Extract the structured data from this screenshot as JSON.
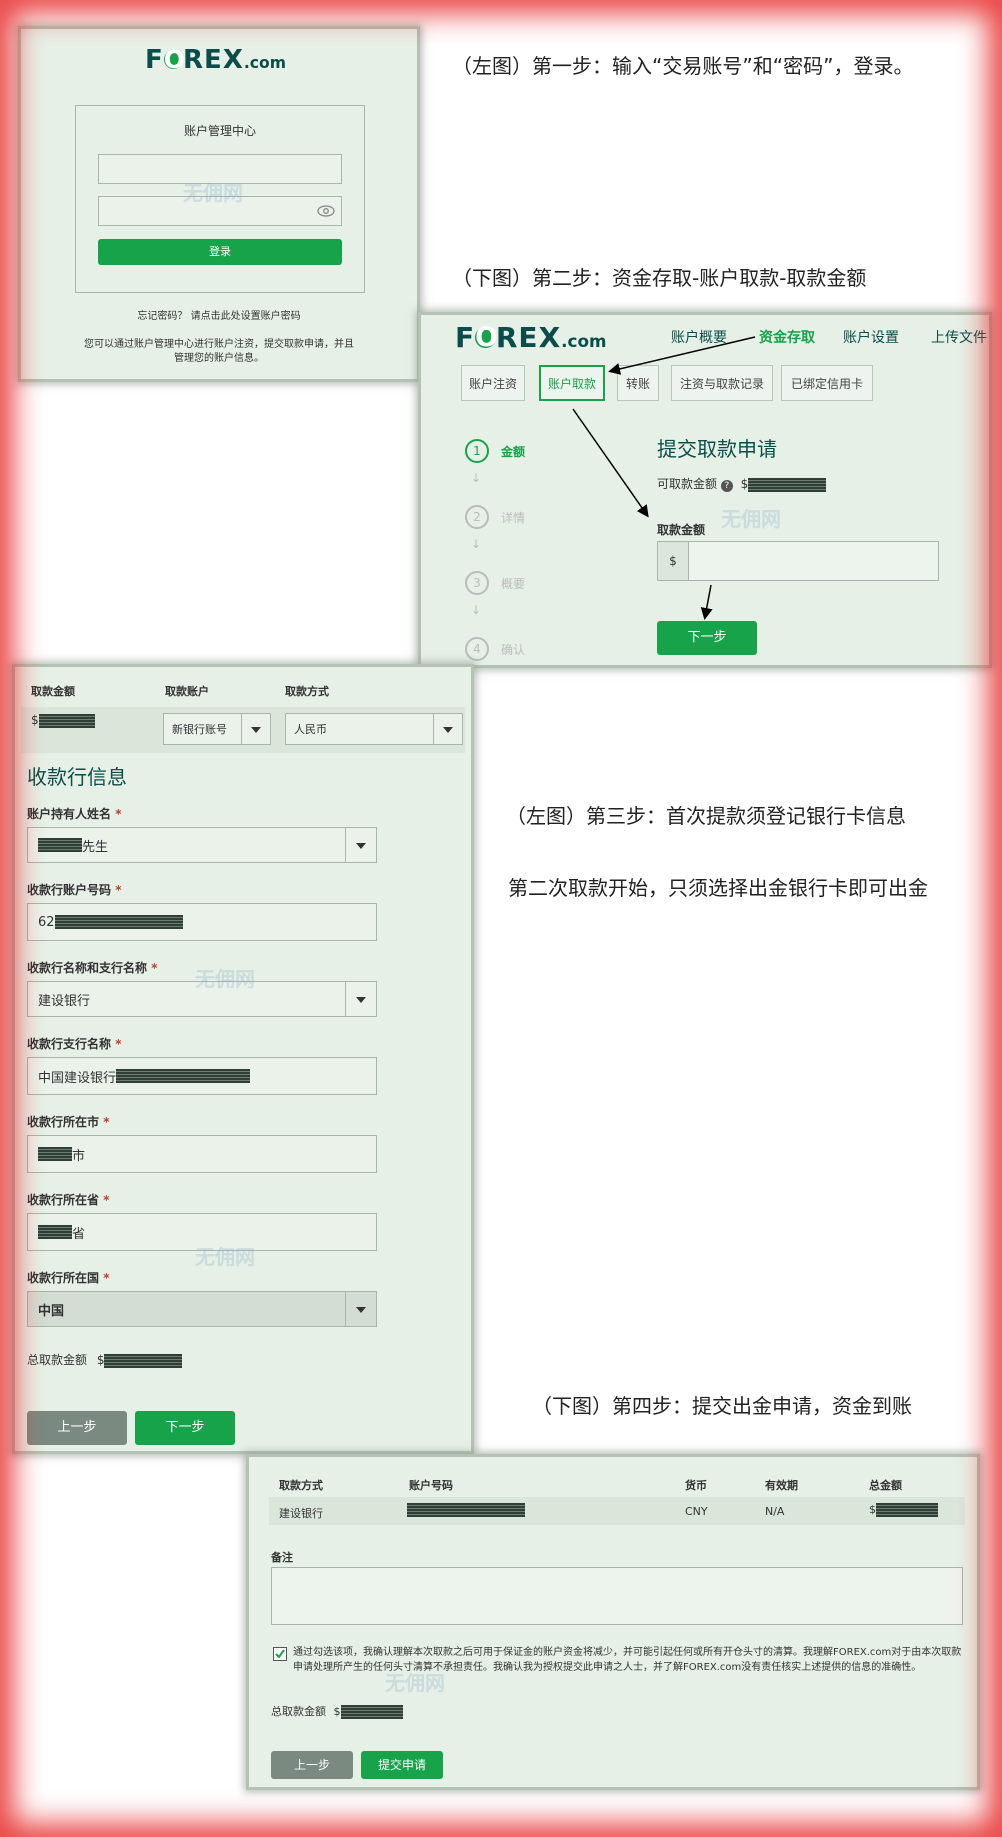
{
  "captions": {
    "step1": "（左图）第一步：输入“交易账号”和“密码”，登录。",
    "step2": "（下图）第二步：资金存取-账户取款-取款金额",
    "step3a": "（左图）第三步：首次提款须登记银行卡信息",
    "step3b": "第二次取款开始，只须选择出金银行卡即可出金",
    "step4": "（下图）第四步：提交出金申请，资金到账"
  },
  "brand": {
    "logo_pre": "F",
    "logo_o": "O",
    "logo_post": "REX",
    "logo_suffix": ".com",
    "accent": "#16a34a"
  },
  "watermark": "无佣网",
  "login": {
    "title": "账户管理中心",
    "account_placeholder": "",
    "password_placeholder": "",
    "login_button": "登录",
    "forgot_text": "忘记密码？ 请点击此处设置账户密码",
    "desc_line1": "您可以通过账户管理中心进行账户注资，提交取款申请，并且",
    "desc_line2": "管理您的账户信息。"
  },
  "withdraw": {
    "nav": [
      "账户概要",
      "资金存取",
      "账户设置",
      "上传文件"
    ],
    "tabs": [
      "账户注资",
      "账户取款",
      "转账",
      "注资与取款记录",
      "已绑定信用卡"
    ],
    "steps": [
      {
        "num": "1",
        "label": "金额"
      },
      {
        "num": "2",
        "label": "详情"
      },
      {
        "num": "3",
        "label": "概要"
      },
      {
        "num": "4",
        "label": "确认"
      }
    ],
    "title": "提交取款申请",
    "available_label": "可取款金额",
    "currency_symbol": "$",
    "amount_label": "取款金额",
    "next_button": "下一步"
  },
  "bank": {
    "headers": [
      "取款金额",
      "取款账户",
      "取款方式"
    ],
    "amount_prefix": "$",
    "account_select": "新银行账号",
    "method_select": "人民币",
    "section_title": "收款行信息",
    "required_mark": "*",
    "fields": [
      {
        "label": "账户持有人姓名",
        "value": "先生"
      },
      {
        "label": "收款行账户号码",
        "value": "62"
      },
      {
        "label": "收款行名称和支行名称",
        "value": "建设银行"
      },
      {
        "label": "收款行支行名称",
        "value": "中国建设银行"
      },
      {
        "label": "收款行所在市",
        "value": "市"
      },
      {
        "label": "收款行所在省",
        "value": "省"
      },
      {
        "label": "收款行所在国",
        "value": "中国"
      }
    ],
    "total_label": "总取款金额",
    "total_prefix": "$",
    "prev_button": "上一步",
    "next_button": "下一步"
  },
  "confirm": {
    "headers": [
      "取款方式",
      "账户号码",
      "货币",
      "有效期",
      "总金额"
    ],
    "row": {
      "method": "建设银行",
      "account": "",
      "currency": "CNY",
      "expiry": "N/A",
      "amount_prefix": "$"
    },
    "remark_label": "备注",
    "agreement": "通过勾选该项，我确认理解本次取款之后可用于保证金的账户资金将减少，并可能引起任何或所有开仓头寸的清算。我理解FOREX.com对于由本次取款申请处理所产生的任何头寸清算不承担责任。我确认我为授权提交此申请之人士，并了解FOREX.com没有责任核实上述提供的信息的准确性。",
    "agreement_checked": true,
    "total_label": "总取款金额",
    "total_prefix": "$",
    "prev_button": "上一步",
    "submit_button": "提交申请"
  }
}
